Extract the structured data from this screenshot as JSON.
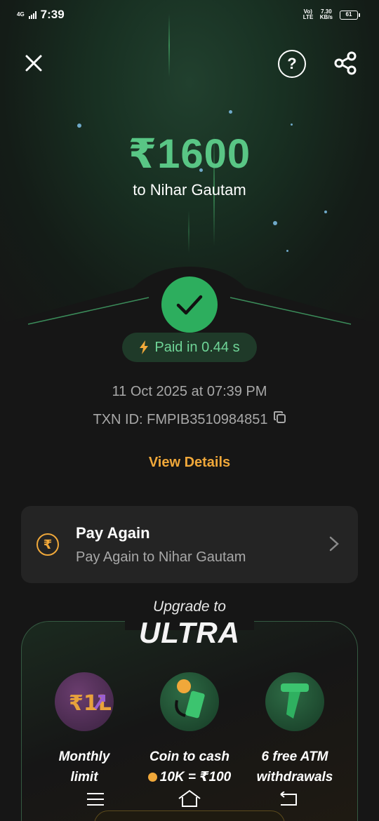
{
  "status_bar": {
    "network": "4G",
    "time": "7:39",
    "volte": "Vo) LTE",
    "speed_value": "7.30",
    "speed_unit": "KB/s",
    "battery": "61"
  },
  "header": {
    "close_icon": "close-icon",
    "help_icon": "help-icon",
    "share_icon": "share-icon"
  },
  "payment": {
    "amount": "₹1600",
    "recipient": "to Nihar Gautam",
    "status_icon": "check-icon",
    "paid_label": "Paid in 0.44 s",
    "datetime": "11 Oct 2025 at 07:39 PM",
    "txn_id": "TXN ID: FMPIB3510984851",
    "view_details": "View Details"
  },
  "pay_again": {
    "title": "Pay Again",
    "subtitle": "Pay Again to Nihar Gautam"
  },
  "ultra": {
    "upgrade_to": "Upgrade to",
    "title": "ULTRA",
    "features": [
      {
        "line1": "Monthly",
        "line2": "limit",
        "icon": "monthly-limit-icon"
      },
      {
        "line1": "Coin to cash",
        "line2": "10K = ₹100",
        "icon": "coin-cash-icon"
      },
      {
        "line1": "6 free ATM",
        "line2": "withdrawals",
        "icon": "atm-icon"
      }
    ]
  },
  "colors": {
    "accent_green": "#59c685",
    "accent_orange": "#f0a83a",
    "background": "#161616",
    "card": "#242424"
  }
}
